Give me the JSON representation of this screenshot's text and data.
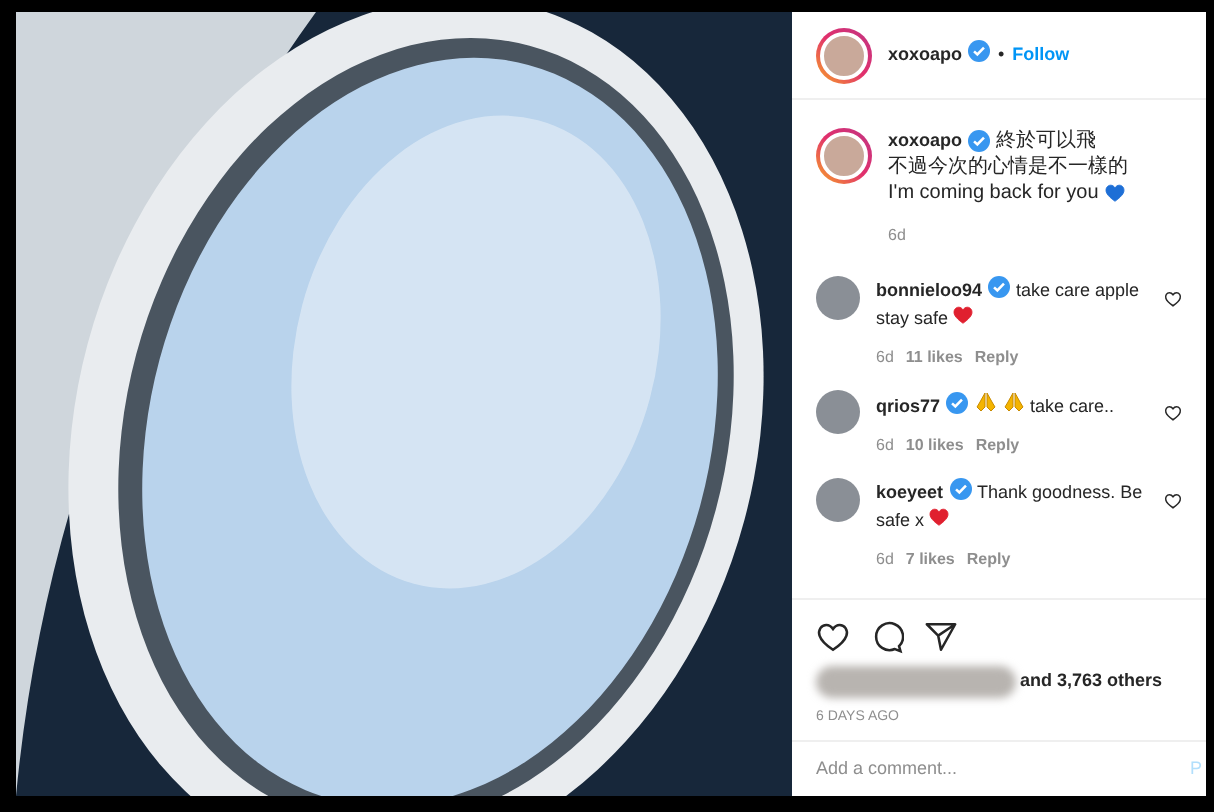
{
  "post": {
    "username": "xoxoapo",
    "verified": true,
    "separator": "•",
    "follow_label": "Follow"
  },
  "caption": {
    "username": "xoxoapo",
    "verified": true,
    "lines": [
      "終於可以飛",
      "不過今次的心情是不一樣的",
      "I'm coming back for you"
    ],
    "end_emoji": {
      "kind": "blue_heart"
    },
    "time": "6d"
  },
  "comments": [
    {
      "username": "bonnieloo94",
      "verified": true,
      "parts": [
        {
          "kind": "text",
          "text": "take care apple stay safe"
        },
        {
          "kind": "red_heart"
        }
      ],
      "time": "6d",
      "likes": "11 likes",
      "reply": "Reply",
      "liked": false
    },
    {
      "username": "qrios77",
      "verified": true,
      "parts": [
        {
          "kind": "pray"
        },
        {
          "kind": "pray"
        },
        {
          "kind": "text",
          "text": "take care.."
        }
      ],
      "time": "6d",
      "likes": "10 likes",
      "reply": "Reply",
      "liked": false
    },
    {
      "username": "koeyeet",
      "verified": true,
      "parts": [
        {
          "kind": "text",
          "text": "Thank goodness. Be safe x"
        },
        {
          "kind": "red_heart"
        }
      ],
      "time": "6d",
      "likes": "7 likes",
      "reply": "Reply",
      "liked": false
    }
  ],
  "likes_summary": "and 3,763 others",
  "date": "6 DAYS AGO",
  "comment_box": {
    "placeholder": "Add a comment...",
    "post_label": "P"
  }
}
